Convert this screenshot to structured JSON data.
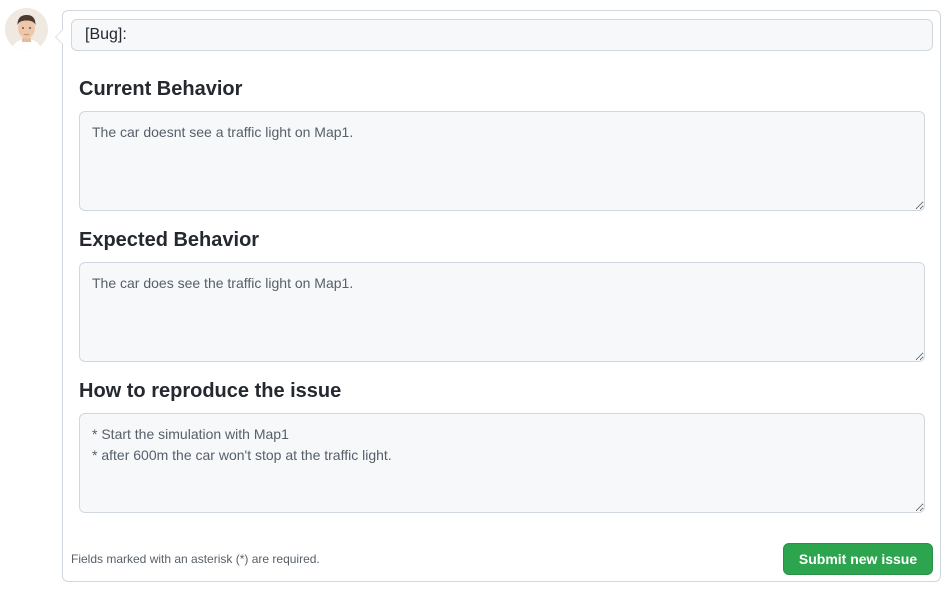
{
  "issue_form": {
    "title_value": "[Bug]: ",
    "sections": [
      {
        "heading": "Current Behavior",
        "value": "The car doesnt see a traffic light on Map1."
      },
      {
        "heading": "Expected Behavior",
        "value": "The car does see the traffic light on Map1."
      },
      {
        "heading": "How to reproduce the issue",
        "value": "* Start the simulation with Map1\n* after 600m the car won't stop at the traffic light."
      }
    ],
    "footer_note": "Fields marked with an asterisk (*) are required.",
    "submit_label": "Submit new issue"
  },
  "colors": {
    "submit_button": "#2da44e",
    "field_background": "#f6f8fa",
    "border": "#d0d7de"
  }
}
